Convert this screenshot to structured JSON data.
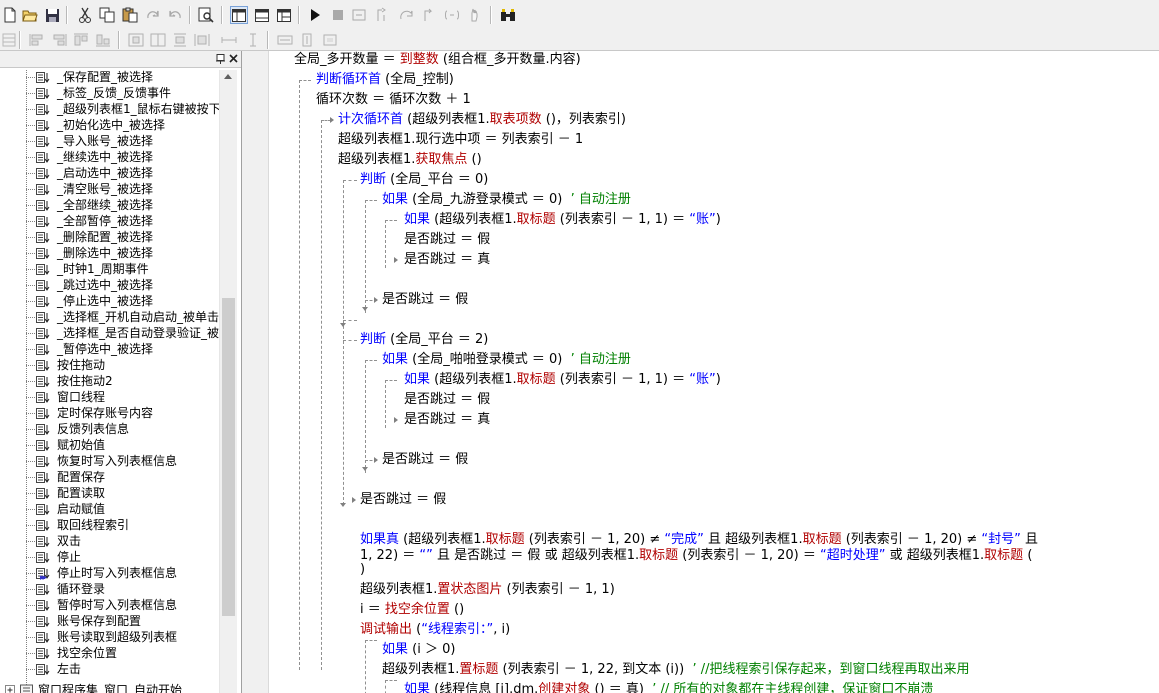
{
  "tree": {
    "items": [
      "_保存配置_被选择",
      "_标签_反馈_反馈事件",
      "_超级列表框1_鼠标右键被按下",
      "_初始化选中_被选择",
      "_导入账号_被选择",
      "_继续选中_被选择",
      "_启动选中_被选择",
      "_清空账号_被选择",
      "_全部继续_被选择",
      "_全部暂停_被选择",
      "_删除配置_被选择",
      "_删除选中_被选择",
      "_时钟1_周期事件",
      "_跳过选中_被选择",
      "_停止选中_被选择",
      "_选择框_开机自动启动_被单击",
      "_选择框_是否自动登录验证_被",
      "_暂停选中_被选择",
      "按住拖动",
      "按住拖动2",
      "窗口线程",
      "定时保存账号内容",
      "反馈列表信息",
      "赋初始值",
      "恢复时写入列表框信息",
      "配置保存",
      "配置读取",
      "启动赋值",
      "取回线程索引",
      "双击",
      "停止",
      "停止时写入列表框信息",
      "循环登录",
      "暂停时写入列表框信息",
      "账号保存到配置",
      "账号读取到超级列表框",
      "找空余位置",
      "左击"
    ],
    "last_item": "窗口程序集_窗口_自动开始"
  },
  "code": {
    "l0": {
      "a": "全局_多开数量 ＝ ",
      "b": "到整数",
      "c": " (组合框_多开数量.内容)"
    },
    "l1": {
      "a": "判断循环首",
      "b": " (全局_控制)"
    },
    "l2": {
      "a": "循环次数 ＝ 循环次数 ＋ 1"
    },
    "l3": {
      "a": "计次循环首",
      "b": " (超级列表框1.",
      "c": "取表项数",
      "d": " ()，列表索引)"
    },
    "l4": {
      "a": "超级列表框1.现行选中项 ＝ 列表索引 － 1"
    },
    "l5": {
      "a": "超级列表框1.",
      "b": "获取焦点",
      "c": " ()"
    },
    "l6": {
      "a": "判断",
      "b": " (全局_平台 ＝ 0)"
    },
    "l7": {
      "a": "如果",
      "b": " (全局_九游登录模式 ＝ 0)  ",
      "c": "’ 自动注册"
    },
    "l8": {
      "a": "如果",
      "b": " (超级列表框1.",
      "c": "取标题",
      "d": " (列表索引 － 1, 1) ＝ ",
      "e": "“账”",
      "f": ")"
    },
    "l9": {
      "a": "是否跳过 ＝ 假"
    },
    "l10": {
      "a": "是否跳过 ＝ 真"
    },
    "l12": {
      "a": "是否跳过 ＝ 假"
    },
    "l14": {
      "a": "判断",
      "b": " (全局_平台 ＝ 2)"
    },
    "l15": {
      "a": "如果",
      "b": " (全局_啪啪登录模式 ＝ 0)  ",
      "c": "’ 自动注册"
    },
    "l16": {
      "a": "如果",
      "b": " (超级列表框1.",
      "c": "取标题",
      "d": " (列表索引 － 1, 1) ＝ ",
      "e": "“账”",
      "f": ")"
    },
    "l17": {
      "a": "是否跳过 ＝ 假"
    },
    "l18": {
      "a": "是否跳过 ＝ 真"
    },
    "l20": {
      "a": "是否跳过 ＝ 假"
    },
    "l22": {
      "a": "是否跳过 ＝ 假"
    },
    "l24": {
      "a": "如果真",
      "b": " (超级列表框1.",
      "c": "取标题",
      "d": " (列表索引 － 1, 20) ≠ ",
      "e": "“完成”",
      "f": " 且 超级列表框1.",
      "g": "取标题",
      "h": " (列表索引 － 1, 20) ≠ ",
      "i": "“封号”",
      "j": " 且"
    },
    "l25": {
      "a": "1, 22) ＝ ",
      "b": "“”",
      "c": " 且 是否跳过 ＝ 假 或 超级列表框1.",
      "d": "取标题",
      "e": " (列表索引 － 1, 20) ＝ ",
      "f": "“超时处理”",
      "g": " 或 超级列表框1.",
      "h": "取标题",
      "i": " ("
    },
    "l26": {
      "a": ")"
    },
    "l27": {
      "a": "超级列表框1.",
      "b": "置状态图片",
      "c": " (列表索引 － 1, 1)"
    },
    "l28": {
      "a": "i ＝ ",
      "b": "找空余位置",
      "c": " ()"
    },
    "l29": {
      "a": "调试输出",
      "b": " (",
      "c": "“线程索引：”",
      "d": ", i)"
    },
    "l30": {
      "a": "如果",
      "b": " (i ＞ 0)"
    },
    "l31": {
      "a": "超级列表框1.",
      "b": "置标题",
      "c": " (列表索引 － 1, 22, 到文本 (i))  ",
      "d": "’ //把线程索引保存起来，到窗口线程再取出来用"
    },
    "l32": {
      "a": "如果",
      "b": " (线程信息 [i].dm.",
      "c": "创建对象",
      "d": " () ＝ 真)  ",
      "e": "’ // 所有的对象都在主线程创建，保证窗口不崩溃"
    }
  }
}
